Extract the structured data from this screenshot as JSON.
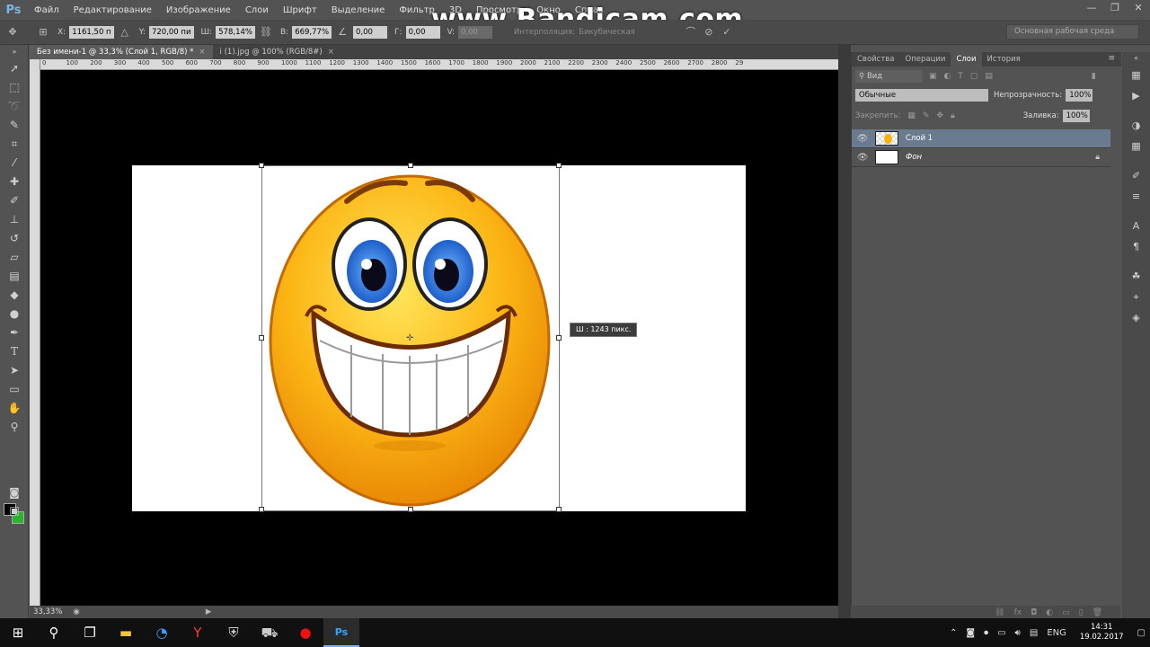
{
  "app": {
    "logo": "Ps",
    "watermark": "www.Bandicam.com"
  },
  "menu": [
    "Файл",
    "Редактирование",
    "Изображение",
    "Слои",
    "Шрифт",
    "Выделение",
    "Фильтр",
    "3D",
    "Просмотр",
    "Окно",
    "Справ"
  ],
  "window_controls": {
    "minimize": "—",
    "restore": "❐",
    "close": "✕"
  },
  "options": {
    "x_label": "X:",
    "x_value": "1161,50 п",
    "y_label": "Y:",
    "y_value": "720,00 пи",
    "w_label": "Ш:",
    "w_value": "578,14%",
    "h_label": "В:",
    "h_value": "669,77%",
    "angle_value": "0,00",
    "hskew_label": "Г:",
    "hskew_value": "0,00",
    "vskew_label": "V:",
    "vskew_value": "0,00",
    "interp_label": "Интерполяция:",
    "interp_value": "Бикубическая",
    "workspace": "Основная рабочая среда"
  },
  "doc_tabs": [
    {
      "label": "Без имени-1 @ 33,3% (Слой 1, RGB/8) *",
      "active": true
    },
    {
      "label": "i (1).jpg @ 100% (RGB/8#)",
      "active": false
    }
  ],
  "ruler_top": [
    "0",
    "100",
    "200",
    "300",
    "400",
    "500",
    "600",
    "700",
    "800",
    "900",
    "1000",
    "1100",
    "1200",
    "1300",
    "1400",
    "1500",
    "1600",
    "1700",
    "1800",
    "1900",
    "2000",
    "2100",
    "2200",
    "2300",
    "2400",
    "2500",
    "2600",
    "2700",
    "2800",
    "29"
  ],
  "size_tooltip": "Ш :  1243 пикс.",
  "status": {
    "zoom": "33,33%"
  },
  "panel": {
    "tabs": [
      "Свойства",
      "Операции",
      "Слои",
      "История"
    ],
    "active_tab": "Слои",
    "filter_label": "Вид",
    "blend_mode": "Обычные",
    "opacity_label": "Непрозрачность:",
    "opacity_value": "100%",
    "lock_label": "Закрепить:",
    "fill_label": "Заливка:",
    "fill_value": "100%",
    "layers": [
      {
        "name": "Слой 1",
        "selected": true,
        "locked": false
      },
      {
        "name": "Фон",
        "selected": false,
        "locked": true
      }
    ]
  },
  "taskbar": {
    "time": "14:31",
    "date": "19.02.2017",
    "lang": "ENG"
  }
}
